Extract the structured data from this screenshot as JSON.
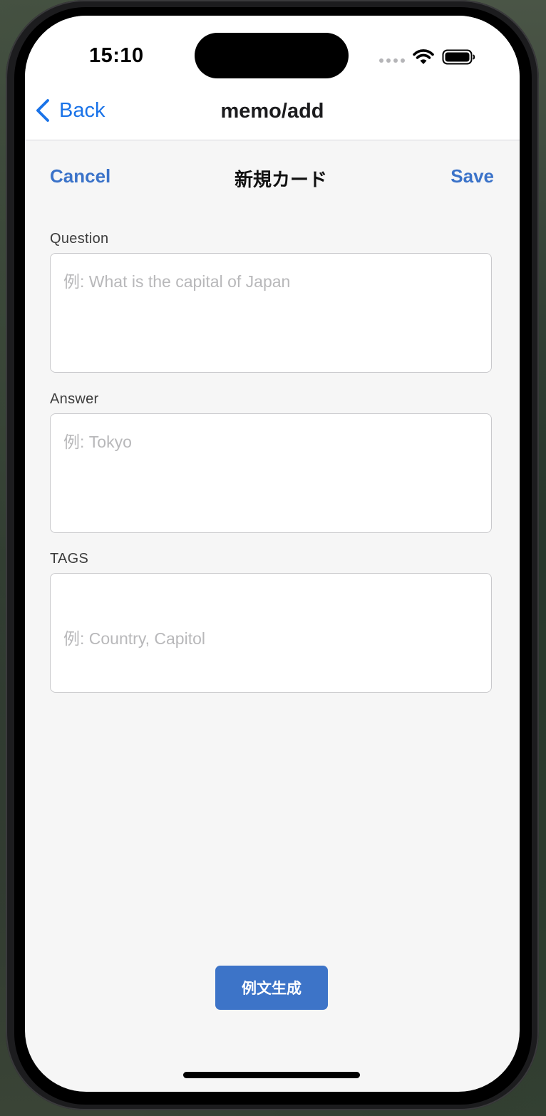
{
  "status_bar": {
    "time": "15:10"
  },
  "nav": {
    "back_label": "Back",
    "title": "memo/add"
  },
  "form_header": {
    "cancel_label": "Cancel",
    "title": "新規カード",
    "save_label": "Save"
  },
  "fields": {
    "question": {
      "label": "Question",
      "value": "",
      "placeholder": "例: What is the capital of Japan"
    },
    "answer": {
      "label": "Answer",
      "value": "",
      "placeholder": "例: Tokyo"
    },
    "tags": {
      "label": "TAGS",
      "value": "",
      "placeholder": "例: Country, Capitol"
    }
  },
  "actions": {
    "generate_label": "例文生成"
  },
  "colors": {
    "accent": "#3b73c9",
    "nav_link": "#1a73e8",
    "button_bg": "#3d74c8",
    "placeholder": "#b8b8ba"
  }
}
